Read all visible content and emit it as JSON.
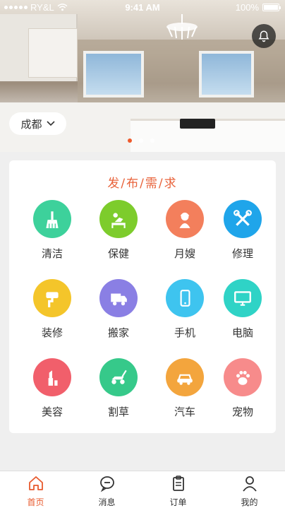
{
  "status_bar": {
    "carrier": "RY&L",
    "time": "9:41 AM",
    "battery": "100%"
  },
  "banner": {
    "city": "成都",
    "page_count": 3,
    "active_page": 1
  },
  "services": {
    "title": "发/布/需/求",
    "items": [
      {
        "label": "清洁",
        "icon": "broom-icon",
        "color": "#3dd19b"
      },
      {
        "label": "保健",
        "icon": "massage-icon",
        "color": "#7dcc2c"
      },
      {
        "label": "月嫂",
        "icon": "nanny-icon",
        "color": "#f37f5c"
      },
      {
        "label": "修理",
        "icon": "tools-icon",
        "color": "#1fa5ea"
      },
      {
        "label": "装修",
        "icon": "paint-roller-icon",
        "color": "#f4c52a"
      },
      {
        "label": "搬家",
        "icon": "truck-icon",
        "color": "#8a7fe4"
      },
      {
        "label": "手机",
        "icon": "phone-icon",
        "color": "#3ec4ef"
      },
      {
        "label": "电脑",
        "icon": "monitor-icon",
        "color": "#2fd3c6"
      },
      {
        "label": "美容",
        "icon": "lipstick-icon",
        "color": "#f15f6b"
      },
      {
        "label": "割草",
        "icon": "lawnmower-icon",
        "color": "#36c98a"
      },
      {
        "label": "汽车",
        "icon": "car-icon",
        "color": "#f3a53d"
      },
      {
        "label": "宠物",
        "icon": "paw-icon",
        "color": "#f78b8b"
      }
    ]
  },
  "tabbar": {
    "items": [
      {
        "label": "首页",
        "icon": "home-icon",
        "active": true
      },
      {
        "label": "消息",
        "icon": "message-icon",
        "active": false
      },
      {
        "label": "订单",
        "icon": "clipboard-icon",
        "active": false
      },
      {
        "label": "我的",
        "icon": "user-icon",
        "active": false
      }
    ]
  },
  "colors": {
    "accent": "#e85a2e",
    "background": "#efefef"
  }
}
